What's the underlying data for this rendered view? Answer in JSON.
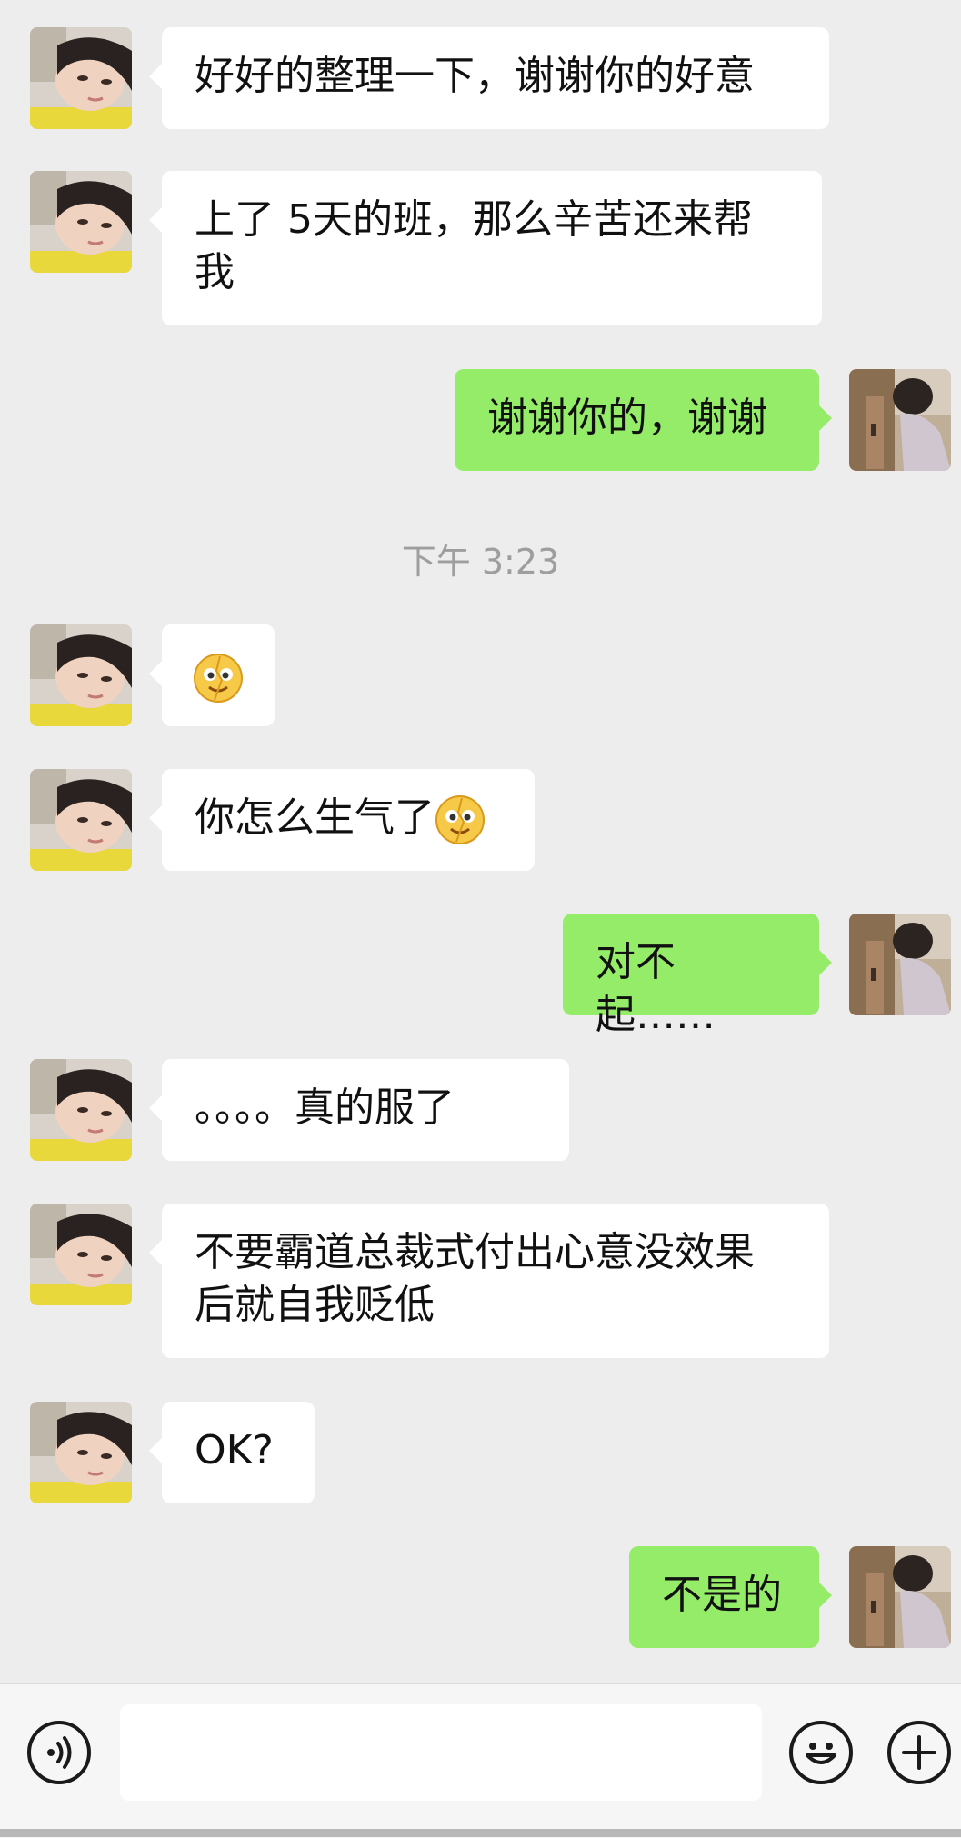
{
  "timestamp": "下午 3:23",
  "messages": [
    {
      "text": "好好的整理一下，谢谢你的好意"
    },
    {
      "line1": "上了 5天的班，那么辛苦还来帮",
      "line2": "我"
    },
    {
      "text": "谢谢你的，谢谢"
    },
    {
      "emoji": "grinning-face-emoji"
    },
    {
      "text": "你怎么生气了",
      "emoji": "grinning-face-emoji"
    },
    {
      "text": "对不起……"
    },
    {
      "text": "。。。。真的服了"
    },
    {
      "line1": "不要霸道总裁式付出心意没效果",
      "line2": "后就自我贬低"
    },
    {
      "text": "OK?"
    },
    {
      "text": "不是的"
    }
  ],
  "input": {
    "value": "",
    "placeholder": ""
  },
  "icons": {
    "voice": "voice-icon",
    "emoji": "emoji-icon",
    "more": "plus-icon"
  },
  "colors": {
    "background": "#ededed",
    "incoming_bubble": "#ffffff",
    "outgoing_bubble": "#95ec69",
    "timestamp": "#9e9e9e"
  }
}
